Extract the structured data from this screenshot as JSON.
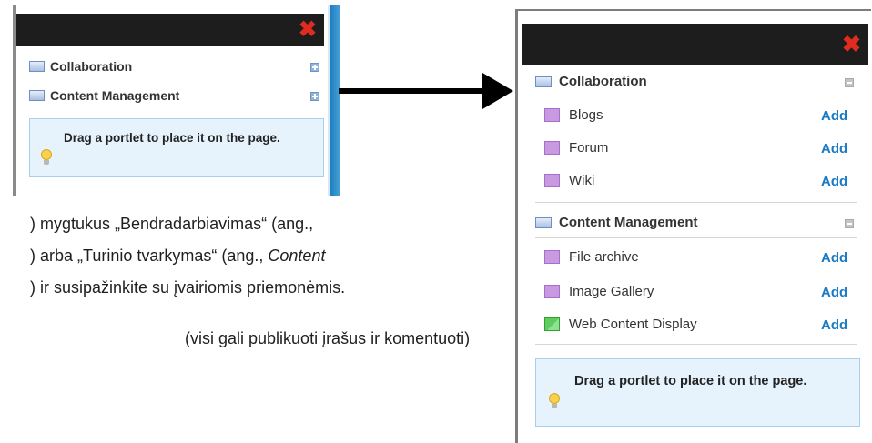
{
  "small_panel": {
    "close_icon": "close-x-icon",
    "categories": [
      {
        "label": "Collaboration",
        "icon": "category-window-icon",
        "toggle": "expand-plus-icon"
      },
      {
        "label": "Content Management",
        "icon": "category-window-icon",
        "toggle": "expand-plus-icon"
      }
    ],
    "tip": {
      "icon": "lightbulb-icon",
      "text": "Drag a portlet to place it on the page."
    }
  },
  "arrow": {
    "direction": "right"
  },
  "paragraph": {
    "line1": ") mygtukus „Bendradarbiavimas“ (ang.,",
    "line2_pre": ") arba „Turinio tvarkymas“ (ang., ",
    "line2_em": "Content",
    "line3_pre": "",
    "line3_rest": ") ir susipažinkite su įvairiomis priemonėmis.",
    "line4": "(visi gali publikuoti įrašus ir komentuoti)"
  },
  "big_panel": {
    "close_icon": "close-x-icon",
    "groups": [
      {
        "label": "Collaboration",
        "toggle": "collapse-minus-icon",
        "items": [
          {
            "label": "Blogs",
            "action": "Add",
            "icon": "portlet-purple-icon"
          },
          {
            "label": "Forum",
            "action": "Add",
            "icon": "portlet-purple-icon"
          },
          {
            "label": "Wiki",
            "action": "Add",
            "icon": "portlet-purple-icon"
          }
        ]
      },
      {
        "label": "Content Management",
        "toggle": "collapse-minus-icon",
        "items": [
          {
            "label": "File archive",
            "action": "Add",
            "icon": "portlet-purple-icon"
          },
          {
            "label": "Image Gallery",
            "action": "Add",
            "icon": "portlet-purple-icon"
          },
          {
            "label": "Web Content Display",
            "action": "Add",
            "icon": "portlet-green-icon"
          }
        ]
      }
    ],
    "tip": {
      "icon": "lightbulb-icon",
      "text": "Drag a portlet to place it on the page."
    }
  },
  "colors": {
    "titlebar": "#1d1d1d",
    "close": "#e02b1f",
    "add_link": "#1a7ac4",
    "tip_background": "#e6f3fc",
    "portlet_purple": "#c89ae0",
    "portlet_green": "#5fcc61"
  }
}
